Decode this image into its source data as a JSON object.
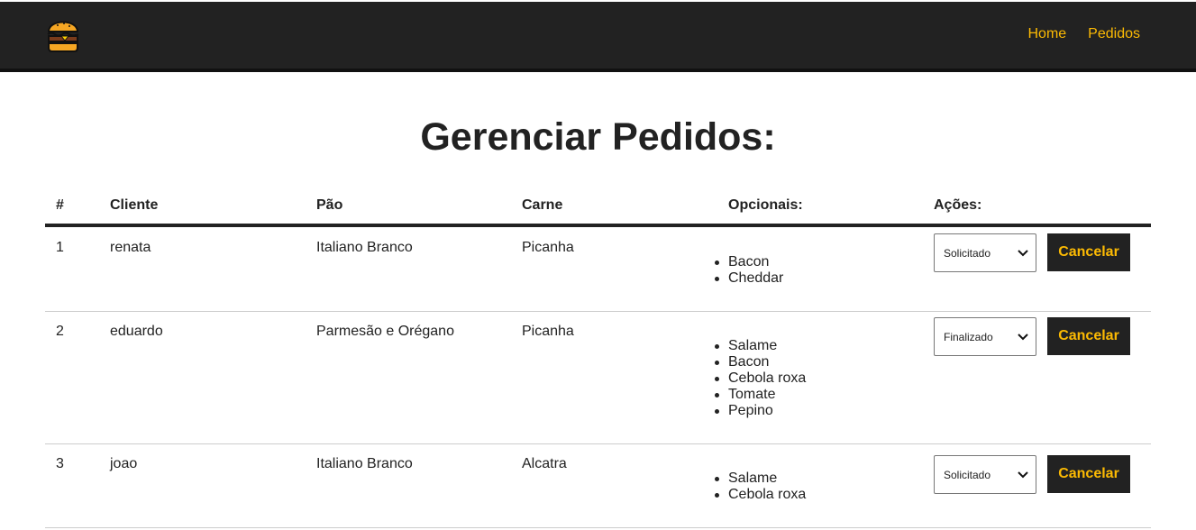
{
  "nav": {
    "home": "Home",
    "pedidos": "Pedidos",
    "logo_icon": "burger-icon"
  },
  "page": {
    "title": "Gerenciar Pedidos:"
  },
  "table": {
    "headers": {
      "id": "#",
      "cliente": "Cliente",
      "pao": "Pão",
      "carne": "Carne",
      "opcionais": "Opcionais:",
      "acoes": "Ações:"
    },
    "rows": [
      {
        "id": "1",
        "cliente": "renata",
        "pao": "Italiano Branco",
        "carne": "Picanha",
        "opcionais": [
          "Bacon",
          "Cheddar"
        ],
        "status": "Solicitado",
        "cancel": "Cancelar"
      },
      {
        "id": "2",
        "cliente": "eduardo",
        "pao": "Parmesão e Orégano",
        "carne": "Picanha",
        "opcionais": [
          "Salame",
          "Bacon",
          "Cebola roxa",
          "Tomate",
          "Pepino"
        ],
        "status": "Finalizado",
        "cancel": "Cancelar"
      },
      {
        "id": "3",
        "cliente": "joao",
        "pao": "Italiano Branco",
        "carne": "Alcatra",
        "opcionais": [
          "Salame",
          "Cebola roxa"
        ],
        "status": "Solicitado",
        "cancel": "Cancelar"
      }
    ]
  },
  "colors": {
    "navbar": "#222222",
    "accent": "#fcba03",
    "text": "#222222"
  }
}
